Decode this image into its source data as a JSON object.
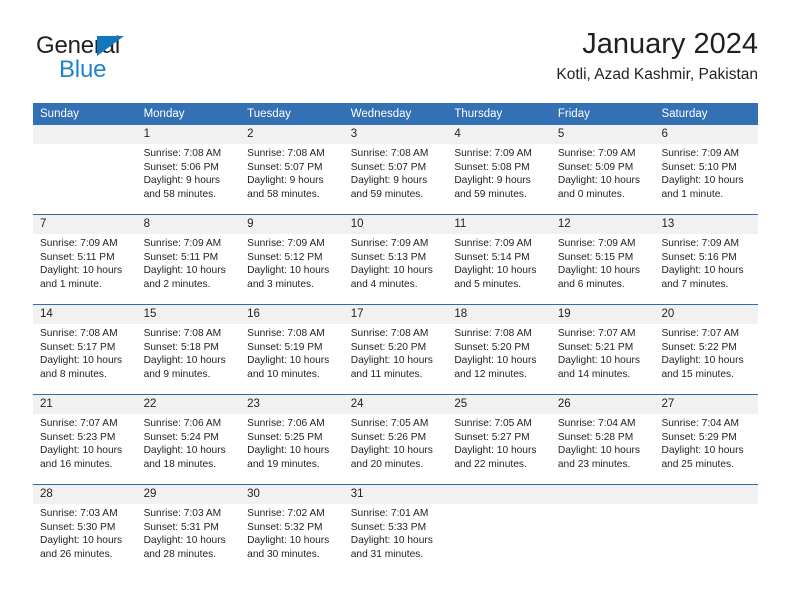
{
  "brand": {
    "name_part1": "General",
    "name_part2": "Blue",
    "triangle_icon": "triangle-icon",
    "color_dark": "#231f20",
    "color_blue": "#1e84cc"
  },
  "header": {
    "title": "January 2024",
    "subtitle": "Kotli, Azad Kashmir, Pakistan"
  },
  "theme": {
    "header_bg": "#3370b4",
    "header_text": "#ffffff",
    "day_band_bg": "#f1f1f1",
    "cell_bg": "#ffffff",
    "divider": "#2e6da8"
  },
  "weekdays": [
    "Sunday",
    "Monday",
    "Tuesday",
    "Wednesday",
    "Thursday",
    "Friday",
    "Saturday"
  ],
  "weeks": [
    [
      {
        "day": ""
      },
      {
        "day": "1",
        "sunrise": "Sunrise: 7:08 AM",
        "sunset": "Sunset: 5:06 PM",
        "daylight1": "Daylight: 9 hours",
        "daylight2": "and 58 minutes."
      },
      {
        "day": "2",
        "sunrise": "Sunrise: 7:08 AM",
        "sunset": "Sunset: 5:07 PM",
        "daylight1": "Daylight: 9 hours",
        "daylight2": "and 58 minutes."
      },
      {
        "day": "3",
        "sunrise": "Sunrise: 7:08 AM",
        "sunset": "Sunset: 5:07 PM",
        "daylight1": "Daylight: 9 hours",
        "daylight2": "and 59 minutes."
      },
      {
        "day": "4",
        "sunrise": "Sunrise: 7:09 AM",
        "sunset": "Sunset: 5:08 PM",
        "daylight1": "Daylight: 9 hours",
        "daylight2": "and 59 minutes."
      },
      {
        "day": "5",
        "sunrise": "Sunrise: 7:09 AM",
        "sunset": "Sunset: 5:09 PM",
        "daylight1": "Daylight: 10 hours",
        "daylight2": "and 0 minutes."
      },
      {
        "day": "6",
        "sunrise": "Sunrise: 7:09 AM",
        "sunset": "Sunset: 5:10 PM",
        "daylight1": "Daylight: 10 hours",
        "daylight2": "and 1 minute."
      }
    ],
    [
      {
        "day": "7",
        "sunrise": "Sunrise: 7:09 AM",
        "sunset": "Sunset: 5:11 PM",
        "daylight1": "Daylight: 10 hours",
        "daylight2": "and 1 minute."
      },
      {
        "day": "8",
        "sunrise": "Sunrise: 7:09 AM",
        "sunset": "Sunset: 5:11 PM",
        "daylight1": "Daylight: 10 hours",
        "daylight2": "and 2 minutes."
      },
      {
        "day": "9",
        "sunrise": "Sunrise: 7:09 AM",
        "sunset": "Sunset: 5:12 PM",
        "daylight1": "Daylight: 10 hours",
        "daylight2": "and 3 minutes."
      },
      {
        "day": "10",
        "sunrise": "Sunrise: 7:09 AM",
        "sunset": "Sunset: 5:13 PM",
        "daylight1": "Daylight: 10 hours",
        "daylight2": "and 4 minutes."
      },
      {
        "day": "11",
        "sunrise": "Sunrise: 7:09 AM",
        "sunset": "Sunset: 5:14 PM",
        "daylight1": "Daylight: 10 hours",
        "daylight2": "and 5 minutes."
      },
      {
        "day": "12",
        "sunrise": "Sunrise: 7:09 AM",
        "sunset": "Sunset: 5:15 PM",
        "daylight1": "Daylight: 10 hours",
        "daylight2": "and 6 minutes."
      },
      {
        "day": "13",
        "sunrise": "Sunrise: 7:09 AM",
        "sunset": "Sunset: 5:16 PM",
        "daylight1": "Daylight: 10 hours",
        "daylight2": "and 7 minutes."
      }
    ],
    [
      {
        "day": "14",
        "sunrise": "Sunrise: 7:08 AM",
        "sunset": "Sunset: 5:17 PM",
        "daylight1": "Daylight: 10 hours",
        "daylight2": "and 8 minutes."
      },
      {
        "day": "15",
        "sunrise": "Sunrise: 7:08 AM",
        "sunset": "Sunset: 5:18 PM",
        "daylight1": "Daylight: 10 hours",
        "daylight2": "and 9 minutes."
      },
      {
        "day": "16",
        "sunrise": "Sunrise: 7:08 AM",
        "sunset": "Sunset: 5:19 PM",
        "daylight1": "Daylight: 10 hours",
        "daylight2": "and 10 minutes."
      },
      {
        "day": "17",
        "sunrise": "Sunrise: 7:08 AM",
        "sunset": "Sunset: 5:20 PM",
        "daylight1": "Daylight: 10 hours",
        "daylight2": "and 11 minutes."
      },
      {
        "day": "18",
        "sunrise": "Sunrise: 7:08 AM",
        "sunset": "Sunset: 5:20 PM",
        "daylight1": "Daylight: 10 hours",
        "daylight2": "and 12 minutes."
      },
      {
        "day": "19",
        "sunrise": "Sunrise: 7:07 AM",
        "sunset": "Sunset: 5:21 PM",
        "daylight1": "Daylight: 10 hours",
        "daylight2": "and 14 minutes."
      },
      {
        "day": "20",
        "sunrise": "Sunrise: 7:07 AM",
        "sunset": "Sunset: 5:22 PM",
        "daylight1": "Daylight: 10 hours",
        "daylight2": "and 15 minutes."
      }
    ],
    [
      {
        "day": "21",
        "sunrise": "Sunrise: 7:07 AM",
        "sunset": "Sunset: 5:23 PM",
        "daylight1": "Daylight: 10 hours",
        "daylight2": "and 16 minutes."
      },
      {
        "day": "22",
        "sunrise": "Sunrise: 7:06 AM",
        "sunset": "Sunset: 5:24 PM",
        "daylight1": "Daylight: 10 hours",
        "daylight2": "and 18 minutes."
      },
      {
        "day": "23",
        "sunrise": "Sunrise: 7:06 AM",
        "sunset": "Sunset: 5:25 PM",
        "daylight1": "Daylight: 10 hours",
        "daylight2": "and 19 minutes."
      },
      {
        "day": "24",
        "sunrise": "Sunrise: 7:05 AM",
        "sunset": "Sunset: 5:26 PM",
        "daylight1": "Daylight: 10 hours",
        "daylight2": "and 20 minutes."
      },
      {
        "day": "25",
        "sunrise": "Sunrise: 7:05 AM",
        "sunset": "Sunset: 5:27 PM",
        "daylight1": "Daylight: 10 hours",
        "daylight2": "and 22 minutes."
      },
      {
        "day": "26",
        "sunrise": "Sunrise: 7:04 AM",
        "sunset": "Sunset: 5:28 PM",
        "daylight1": "Daylight: 10 hours",
        "daylight2": "and 23 minutes."
      },
      {
        "day": "27",
        "sunrise": "Sunrise: 7:04 AM",
        "sunset": "Sunset: 5:29 PM",
        "daylight1": "Daylight: 10 hours",
        "daylight2": "and 25 minutes."
      }
    ],
    [
      {
        "day": "28",
        "sunrise": "Sunrise: 7:03 AM",
        "sunset": "Sunset: 5:30 PM",
        "daylight1": "Daylight: 10 hours",
        "daylight2": "and 26 minutes."
      },
      {
        "day": "29",
        "sunrise": "Sunrise: 7:03 AM",
        "sunset": "Sunset: 5:31 PM",
        "daylight1": "Daylight: 10 hours",
        "daylight2": "and 28 minutes."
      },
      {
        "day": "30",
        "sunrise": "Sunrise: 7:02 AM",
        "sunset": "Sunset: 5:32 PM",
        "daylight1": "Daylight: 10 hours",
        "daylight2": "and 30 minutes."
      },
      {
        "day": "31",
        "sunrise": "Sunrise: 7:01 AM",
        "sunset": "Sunset: 5:33 PM",
        "daylight1": "Daylight: 10 hours",
        "daylight2": "and 31 minutes."
      },
      {
        "day": ""
      },
      {
        "day": ""
      },
      {
        "day": ""
      }
    ]
  ]
}
